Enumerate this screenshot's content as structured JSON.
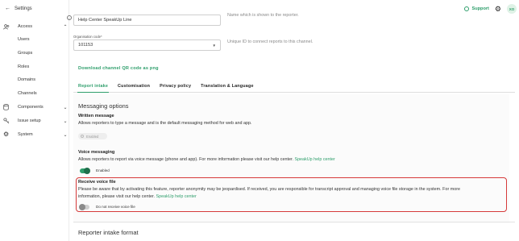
{
  "sidebar": {
    "back_label": "Settings",
    "groups": [
      {
        "label": "Access",
        "icon": "users-icon",
        "expanded": true,
        "items": [
          "Users",
          "Groups",
          "Roles",
          "Domains",
          "Channels"
        ]
      },
      {
        "label": "Components",
        "icon": "database-icon",
        "expanded": false
      },
      {
        "label": "Issue setup",
        "icon": "key-icon",
        "expanded": false
      },
      {
        "label": "System",
        "icon": "gear-icon",
        "expanded": false
      }
    ]
  },
  "header": {
    "support_label": "Support",
    "avatar_initials": "XO"
  },
  "form": {
    "name_value": "Help Center SpeakUp Line",
    "name_help": "Name which is shown to the reporter.",
    "org_code_caption": "Organisation code*",
    "org_code_value": "101153",
    "org_code_help": "Unique ID to connect reports to this channel.",
    "qr_link": "Download channel QR code as png"
  },
  "tabs": [
    {
      "label": "Report intake",
      "active": true
    },
    {
      "label": "Customisation",
      "active": false
    },
    {
      "label": "Privacy policy",
      "active": false
    },
    {
      "label": "Translation & Language",
      "active": false
    }
  ],
  "messaging": {
    "title": "Messaging options",
    "written": {
      "title": "Written message",
      "description": "Allows reporters to type a message and is the default messaging method for web and app.",
      "status": "Enabled"
    },
    "voice": {
      "title": "Voice messaging",
      "description": "Allows reporters to report via voice message (phone and app). For more information please visit our help center.",
      "link": "SpeakUp help center",
      "toggle_on": true,
      "toggle_label": "Enabled"
    },
    "receive_voice": {
      "title": "Receive voice file",
      "description_line1": "Please be aware that by activating this feature, reporter anonymity may be jeopardised. If received, you are responsible for transcript approval and managing voice file storage in the system. For more",
      "description_line2": "information, please visit our help center.",
      "link": "SpeakUp help center",
      "toggle_on": false,
      "toggle_label": "Do not receive voice file"
    }
  },
  "reporter_intake": {
    "title": "Reporter intake format"
  },
  "colors": {
    "accent": "#2e9e6b",
    "highlight": "#d63a3a"
  }
}
